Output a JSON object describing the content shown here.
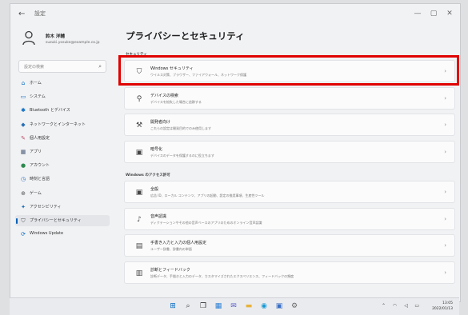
{
  "window": {
    "app_title": "設定",
    "controls": [
      "—",
      "▢",
      "✕"
    ]
  },
  "user": {
    "name": "鈴木 洋輔",
    "email": "suzuki.yosuke@example.co.jp"
  },
  "search": {
    "placeholder": "設定の検索"
  },
  "sidebar": {
    "items": [
      {
        "label": "ホーム",
        "icon": "home-icon",
        "color": "#0067c0"
      },
      {
        "label": "システム",
        "icon": "monitor-icon",
        "color": "#0067c0"
      },
      {
        "label": "Bluetooth とデバイス",
        "icon": "bluetooth-icon",
        "color": "#0067c0"
      },
      {
        "label": "ネットワークとインターネット",
        "icon": "network-icon",
        "color": "#2a6fb5"
      },
      {
        "label": "個人用設定",
        "icon": "brush-icon",
        "color": "#c0506a"
      },
      {
        "label": "アプリ",
        "icon": "apps-icon",
        "color": "#4a5a78"
      },
      {
        "label": "アカウント",
        "icon": "account-icon",
        "color": "#2d8a4f"
      },
      {
        "label": "時刻と言語",
        "icon": "clock-globe-icon",
        "color": "#2a6fb5"
      },
      {
        "label": "ゲーム",
        "icon": "gamepad-icon",
        "color": "#555555"
      },
      {
        "label": "アクセシビリティ",
        "icon": "accessibility-icon",
        "color": "#1f6fb2"
      },
      {
        "label": "プライバシーとセキュリティ",
        "icon": "shield-icon",
        "color": "#555555",
        "selected": true
      },
      {
        "label": "Windows Update",
        "icon": "update-icon",
        "color": "#0067c0"
      }
    ]
  },
  "main": {
    "page_title": "プライバシーとセキュリティ",
    "sections": [
      {
        "title": "セキュリティ",
        "cards": [
          {
            "title": "Windows セキュリティ",
            "desc": "ウイルス対策、ブラウザー、ファイアウォール、ネットワーク保護",
            "icon": "shield-icon"
          },
          {
            "title": "デバイスの検索",
            "desc": "デバイスを紛失した場合に追跡する",
            "icon": "person-pin-icon"
          },
          {
            "title": "開発者向け",
            "desc": "これらの設定は開発目的でのみ使用します",
            "icon": "developer-tools-icon"
          },
          {
            "title": "暗号化",
            "desc": "デバイスのデータを保護するのに役立ちます",
            "icon": "lock-icon"
          }
        ]
      },
      {
        "title": "Windows のアクセス許可",
        "cards": [
          {
            "title": "全般",
            "desc": "広告 ID、ローカル コンテンツ、アプリの起動、設定の推奨事項、生産性ツール",
            "icon": "lock-icon"
          },
          {
            "title": "音声認識",
            "desc": "ディクテーションやその他の音声ベースのアプリのためのオンライン音声認識",
            "icon": "microphone-icon"
          },
          {
            "title": "手書き入力と入力の個人用設定",
            "desc": "ユーザー辞書、辞書内の単語",
            "icon": "notepad-icon"
          },
          {
            "title": "診断とフィードバック",
            "desc": "診断データ、手描きと入力のデータ、カスタマイズされたエクスペリエンス、フィードバックの頻度",
            "icon": "diagnostics-icon"
          }
        ]
      }
    ]
  },
  "taskbar": {
    "apps": [
      {
        "name": "start-icon",
        "color": "#0067c0"
      },
      {
        "name": "search-icon",
        "color": "#444444"
      },
      {
        "name": "task-view-icon",
        "color": "#333333"
      },
      {
        "name": "widgets-icon",
        "color": "#2b7fd6"
      },
      {
        "name": "chat-icon",
        "color": "#5b5fc7"
      },
      {
        "name": "file-explorer-icon",
        "color": "#e8b23a"
      },
      {
        "name": "edge-icon",
        "color": "#1a9ad6"
      },
      {
        "name": "store-icon",
        "color": "#3a6fc4"
      },
      {
        "name": "settings-icon",
        "color": "#6b6b6b"
      }
    ],
    "clock_time": "13:05",
    "clock_date": "2022/01/13"
  },
  "colors": {
    "accent": "#005fb8",
    "highlight": "#e00000"
  }
}
